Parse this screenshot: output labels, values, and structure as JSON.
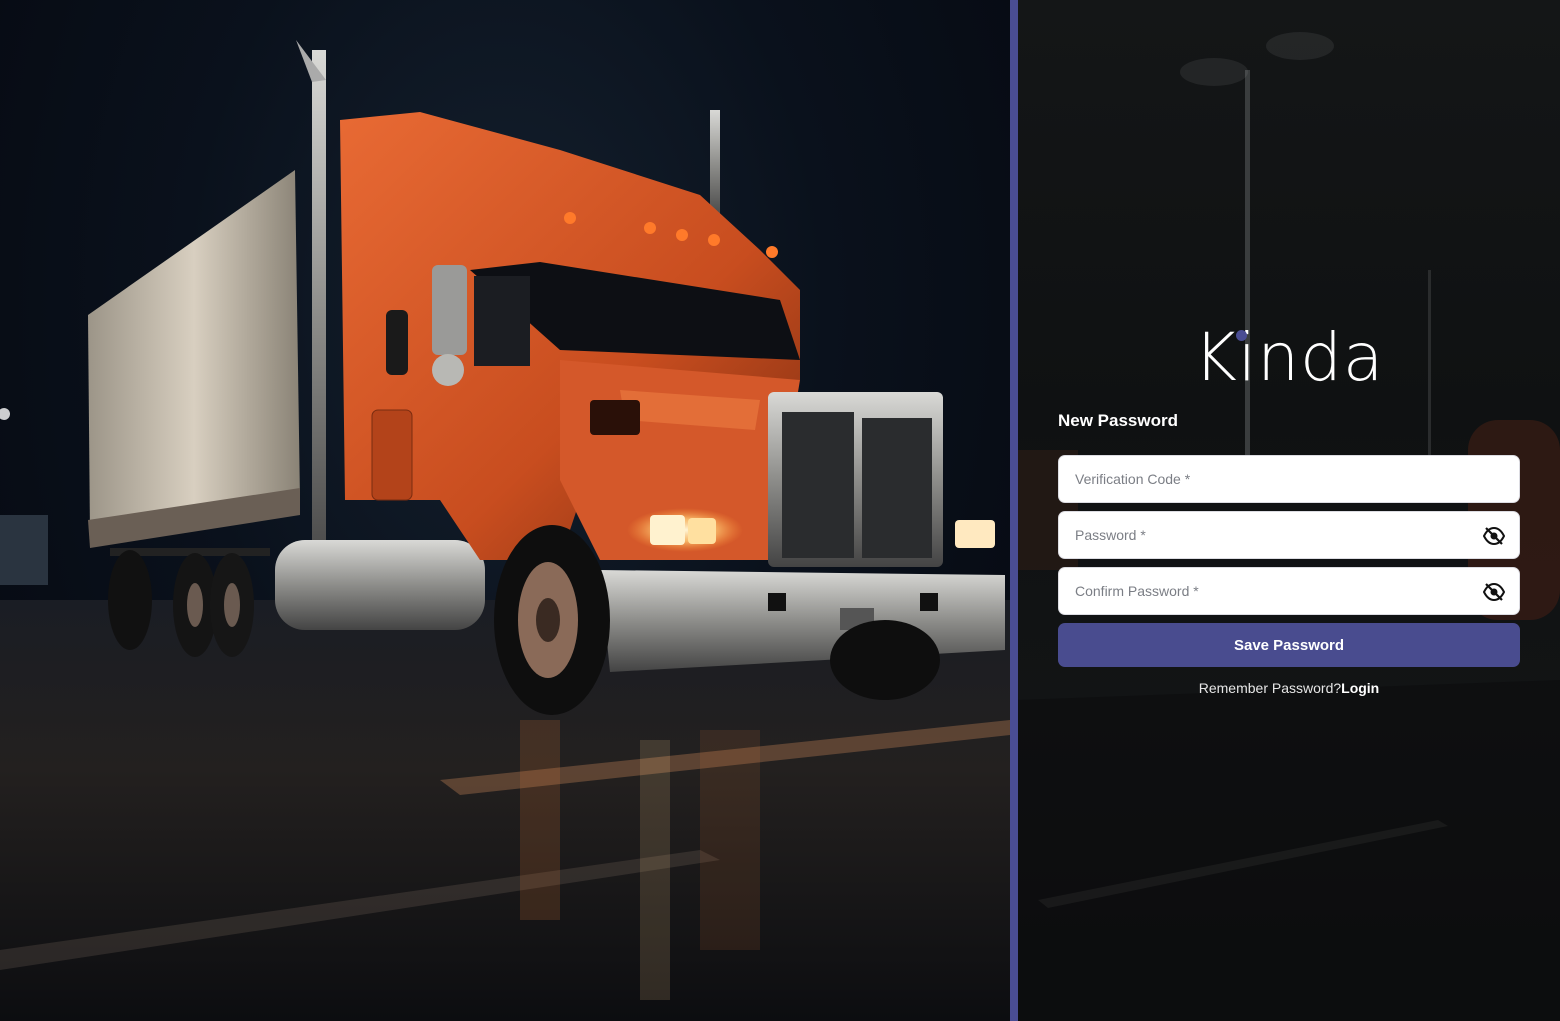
{
  "brand": {
    "name": "Kinda",
    "accent_color": "#4a4d93"
  },
  "form": {
    "title": "New Password",
    "verification_code": {
      "placeholder": "Verification Code *",
      "value": ""
    },
    "password": {
      "placeholder": "Password *",
      "value": "",
      "toggle_icon": "eye-slash-icon"
    },
    "confirm_password": {
      "placeholder": "Confirm Password *",
      "value": "",
      "toggle_icon": "eye-slash-icon"
    },
    "submit_label": "Save Password",
    "remember_text": "Remember Password?",
    "login_link": "Login"
  },
  "hero": {
    "image_description": "orange semi truck at night"
  }
}
